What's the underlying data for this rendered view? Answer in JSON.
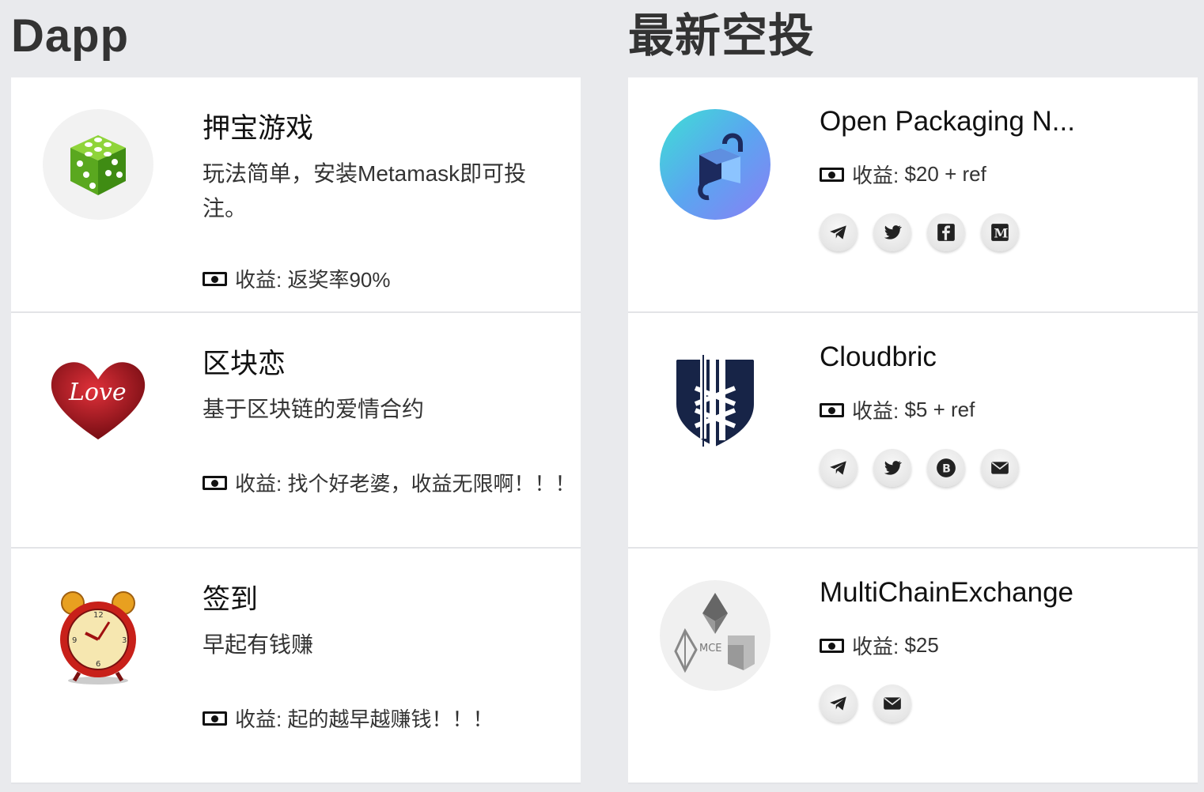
{
  "dapp": {
    "heading": "Dapp",
    "items": [
      {
        "title": "押宝游戏",
        "desc": "玩法简单，安装Metamask即可投注。",
        "reward_label": "收益:",
        "reward_value": "返奖率90%",
        "icon": "dice-icon"
      },
      {
        "title": "区块恋",
        "desc": "基于区块链的爱情合约",
        "reward_label": "收益:",
        "reward_value": "找个好老婆，收益无限啊！！！",
        "icon": "love-heart-icon"
      },
      {
        "title": "签到",
        "desc": "早起有钱赚",
        "reward_label": "收益:",
        "reward_value": "起的越早越赚钱！！！",
        "icon": "alarm-clock-icon"
      }
    ]
  },
  "airdrop": {
    "heading": "最新空投",
    "items": [
      {
        "title": "Open Packaging N...",
        "reward_label": "收益:",
        "reward_value": "$20 + ref",
        "icon": "open-packaging-logo",
        "socials": [
          "telegram-icon",
          "twitter-icon",
          "facebook-icon",
          "medium-icon"
        ]
      },
      {
        "title": "Cloudbric",
        "reward_label": "收益:",
        "reward_value": "$5 + ref",
        "icon": "cloudbric-shield-logo",
        "socials": [
          "telegram-icon",
          "twitter-icon",
          "bitcoin-icon",
          "email-icon"
        ]
      },
      {
        "title": "MultiChainExchange",
        "reward_label": "收益:",
        "reward_value": "$25",
        "icon": "mce-logo",
        "socials": [
          "telegram-icon",
          "email-icon"
        ]
      }
    ]
  },
  "colors": {
    "background": "#e9eaed",
    "card": "#ffffff",
    "text": "#333333"
  }
}
